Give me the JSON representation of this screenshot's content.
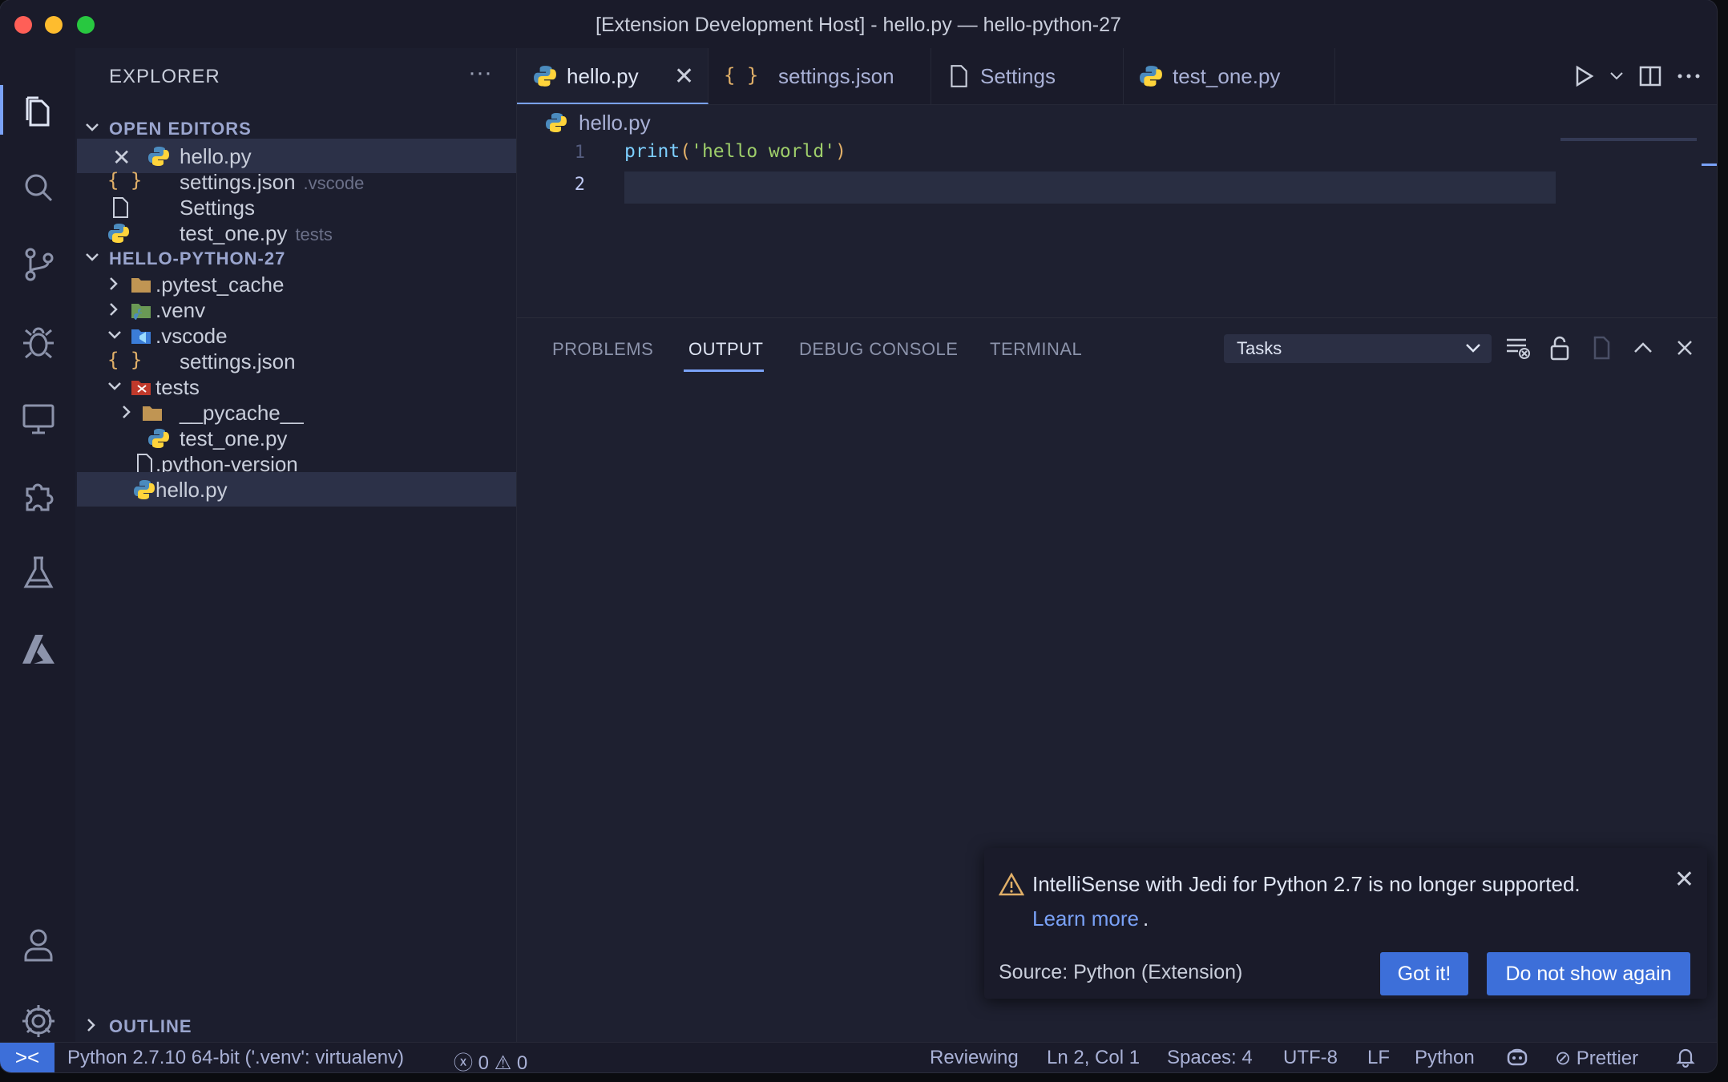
{
  "window": {
    "title": "[Extension Development Host] - hello.py — hello-python-27"
  },
  "activity_bar": {
    "items": [
      "explorer",
      "search",
      "source-control",
      "run-debug",
      "remote-explorer",
      "extensions",
      "testing",
      "azure"
    ],
    "bottom": [
      "accounts",
      "manage"
    ]
  },
  "sidebar": {
    "header": "EXPLORER",
    "more": "···",
    "open_editors_label": "OPEN EDITORS",
    "open_editors": [
      {
        "name": "hello.py",
        "desc": "",
        "icon": "python"
      },
      {
        "name": "settings.json",
        "desc": ".vscode",
        "icon": "json"
      },
      {
        "name": "Settings",
        "desc": "",
        "icon": "file"
      },
      {
        "name": "test_one.py",
        "desc": "tests",
        "icon": "python"
      }
    ],
    "folder_label": "HELLO-PYTHON-27",
    "tree": [
      {
        "name": ".pytest_cache"
      },
      {
        "name": ".venv"
      },
      {
        "name": ".vscode"
      },
      {
        "name": "settings.json"
      },
      {
        "name": "tests"
      },
      {
        "name": "__pycache__"
      },
      {
        "name": "test_one.py"
      },
      {
        "name": ".python-version"
      },
      {
        "name": "hello.py"
      }
    ],
    "outline_label": "OUTLINE"
  },
  "tabs": [
    {
      "label": "hello.py",
      "icon": "python",
      "active": true
    },
    {
      "label": "settings.json",
      "icon": "json",
      "active": false
    },
    {
      "label": "Settings",
      "icon": "file",
      "active": false
    },
    {
      "label": "test_one.py",
      "icon": "python",
      "active": false
    }
  ],
  "breadcrumb": {
    "file": "hello.py"
  },
  "editor": {
    "lines": [
      {
        "number": "1",
        "code": "print('hello world')"
      },
      {
        "number": "2",
        "code": ""
      }
    ]
  },
  "panel": {
    "tabs": [
      "PROBLEMS",
      "OUTPUT",
      "DEBUG CONSOLE",
      "TERMINAL"
    ],
    "active_tab": "OUTPUT",
    "channel": "Tasks"
  },
  "notification": {
    "message": "IntelliSense with Jedi for Python 2.7 is no longer supported.",
    "link": "Learn more",
    "link_suffix": ".",
    "source": "Source: Python (Extension)",
    "primary_button": "Got it!",
    "secondary_button": "Do not show again"
  },
  "statusbar": {
    "remote": "><",
    "interpreter": "Python 2.7.10 64-bit ('.venv': virtualenv)",
    "errors": "0",
    "warnings": "0",
    "reviewing": "Reviewing",
    "position": "Ln 2, Col 1",
    "spaces": "Spaces: 4",
    "encoding": "UTF-8",
    "eol": "LF",
    "language": "Python",
    "formatter": "Prettier"
  },
  "colors": {
    "accent": "#3d6fd9",
    "background": "#1e2030",
    "python_blue": "#4b8bbe",
    "python_yellow": "#ffd43b",
    "json_yellow": "#e0af68",
    "warning": "#e0af68"
  }
}
